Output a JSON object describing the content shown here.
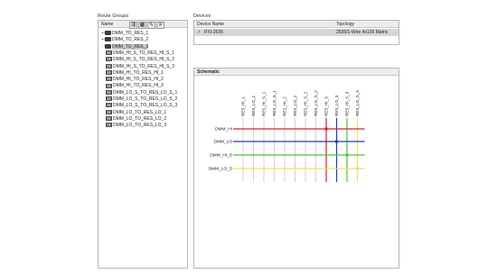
{
  "route_groups": {
    "title": "Route Groups",
    "column": "Name",
    "toolbar": [
      "add-route-group-icon",
      "add-route-icon",
      "edit-icon",
      "delete-icon"
    ],
    "items": [
      {
        "label": "DMM_TO_RES_1",
        "kind": "group",
        "toggle": "+"
      },
      {
        "label": "DMM_TO_RES_2",
        "kind": "group",
        "toggle": "+"
      },
      {
        "label": "DMM_TO_RES_3",
        "kind": "group",
        "toggle": "-",
        "selected": true
      },
      {
        "label": "DMM_HI_S_TO_RES_HI_S_1",
        "kind": "route"
      },
      {
        "label": "DMM_HI_S_TO_RES_HI_S_2",
        "kind": "route"
      },
      {
        "label": "DMM_HI_S_TO_RES_HI_S_3",
        "kind": "route"
      },
      {
        "label": "DMM_HI_TO_RES_HI_1",
        "kind": "route"
      },
      {
        "label": "DMM_HI_TO_RES_HI_2",
        "kind": "route"
      },
      {
        "label": "DMM_HI_TO_RES_HI_3",
        "kind": "route"
      },
      {
        "label": "DMM_LO_S_TO_RES_LO_S_1",
        "kind": "route"
      },
      {
        "label": "DMM_LO_S_TO_RES_LO_S_2",
        "kind": "route"
      },
      {
        "label": "DMM_LO_S_TO_RES_LO_S_3",
        "kind": "route"
      },
      {
        "label": "DMM_LO_TO_RES_LO_1",
        "kind": "route"
      },
      {
        "label": "DMM_LO_TO_RES_LO_2",
        "kind": "route"
      },
      {
        "label": "DMM_LO_TO_RES_LO_3",
        "kind": "route"
      }
    ]
  },
  "devices": {
    "title": "Devices",
    "columns": {
      "name": "Device Name",
      "topology": "Topology"
    },
    "rows": [
      {
        "check": "✓",
        "name": "PXI-2535",
        "topology": "2535/1-Wire 4x136 Matrix"
      }
    ]
  },
  "schematic": {
    "title": "Schematic",
    "columns": [
      "RES_HI_1",
      "RES_LO_1",
      "RES_HI_S_1",
      "RES_LO_S_1",
      "RES_HI_2",
      "RES_LO_2",
      "RES_HI_S_2",
      "RES_LO_S_2",
      "RES_HI_3",
      "RES_LO_3",
      "RES_HI_S_3",
      "RES_LO_S_3"
    ],
    "rows": [
      "DMM_HI",
      "DMM_LO",
      "DMM_HI_S",
      "DMM_LO_S"
    ],
    "colors": {
      "DMM_HI": "#e02020",
      "DMM_LO": "#1a3cc8",
      "DMM_HI_S": "#44cc33",
      "DMM_LO_S": "#f0e060",
      "idle": "#c8c8c8"
    },
    "connections": [
      {
        "row": "DMM_HI",
        "col": 8
      },
      {
        "row": "DMM_LO",
        "col": 9
      },
      {
        "row": "DMM_HI_S",
        "col": 10
      },
      {
        "row": "DMM_LO_S",
        "col": 11
      }
    ]
  }
}
